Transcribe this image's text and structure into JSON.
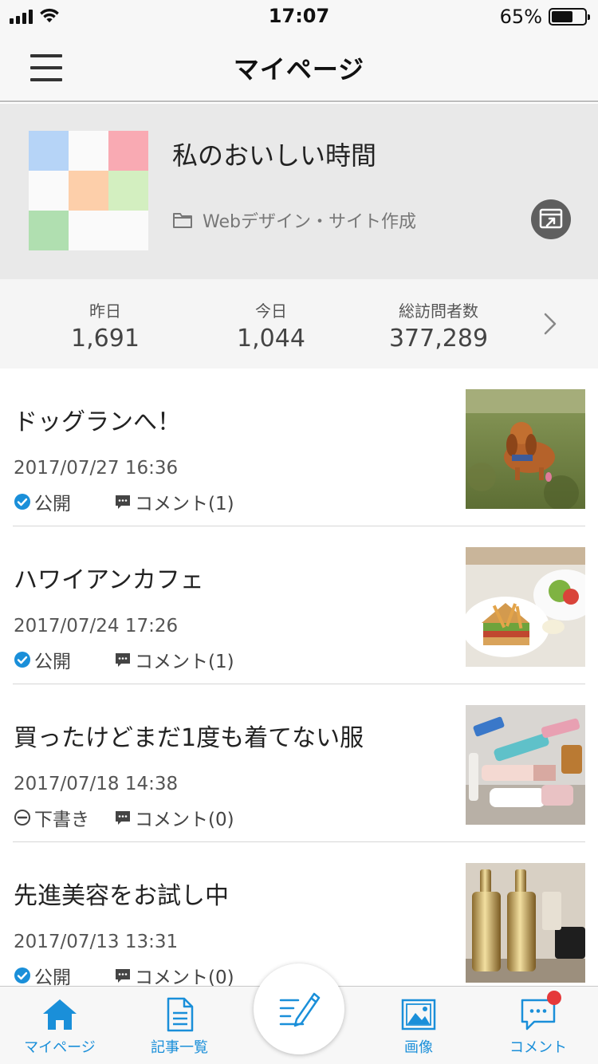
{
  "status_bar": {
    "time": "17:07",
    "battery_percent": "65%"
  },
  "nav": {
    "title": "マイページ"
  },
  "profile": {
    "blog_title": "私のおいしい時間",
    "category": "Webデザイン・サイト作成"
  },
  "stats": {
    "yesterday": {
      "label": "昨日",
      "value": "1,691"
    },
    "today": {
      "label": "今日",
      "value": "1,044"
    },
    "total": {
      "label": "総訪問者数",
      "value": "377,289"
    }
  },
  "articles": [
    {
      "title": "ドッグランへ！",
      "date": "2017/07/27 16:36",
      "status": "公開",
      "comment": "コメント(1)"
    },
    {
      "title": "ハワイアンカフェ",
      "date": "2017/07/24 17:26",
      "status": "公開",
      "comment": "コメント(1)"
    },
    {
      "title": "買ったけどまだ1度も着てない服",
      "date": "2017/07/18 14:38",
      "status": "下書き",
      "comment": "コメント(0)"
    },
    {
      "title": "先進美容をお試し中",
      "date": "2017/07/13 13:31",
      "status": "公開",
      "comment": "コメント(0)"
    }
  ],
  "tabbar": {
    "mypage": "マイページ",
    "articles": "記事一覧",
    "images": "画像",
    "comments": "コメント"
  },
  "colors": {
    "accent": "#1a8fd9",
    "badge": "#e5393a",
    "status_published": "#1a8fd9"
  }
}
